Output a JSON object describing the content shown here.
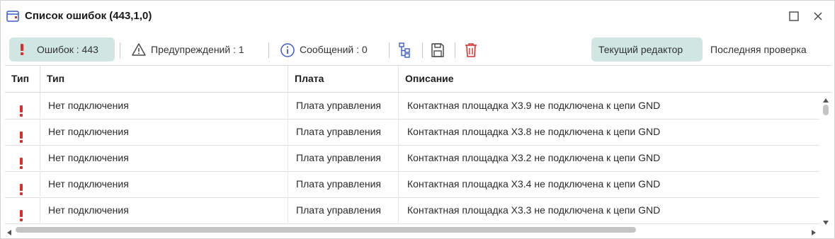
{
  "window": {
    "title": "Список ошибок (443,1,0)",
    "icon": "error-list-window-icon",
    "controls": [
      "maximize-icon",
      "close-icon"
    ]
  },
  "toolbar": {
    "errors_label": "Ошибок : 443",
    "warnings_label": "Предупреждений : 1",
    "messages_label": "Сообщений : 0",
    "icons": [
      "error-icon",
      "warning-icon",
      "info-icon",
      "tree-view-icon",
      "save-icon",
      "delete-icon"
    ],
    "current_editor_label": "Текущий редактор",
    "last_check_label": "Последняя проверка"
  },
  "table": {
    "columns": [
      "Тип",
      "Тип",
      "Плата",
      "Описание"
    ],
    "rows": [
      {
        "severity": "error",
        "type": "Нет подключения",
        "board": "Плата управления",
        "description": "Контактная площадка X3.9 не подключена к цепи GND"
      },
      {
        "severity": "error",
        "type": "Нет подключения",
        "board": "Плата управления",
        "description": "Контактная площадка X3.8 не подключена к цепи GND"
      },
      {
        "severity": "error",
        "type": "Нет подключения",
        "board": "Плата управления",
        "description": "Контактная площадка X3.2 не подключена к цепи GND"
      },
      {
        "severity": "error",
        "type": "Нет подключения",
        "board": "Плата управления",
        "description": "Контактная площадка X3.4 не подключена к цепи GND"
      },
      {
        "severity": "error",
        "type": "Нет подключения",
        "board": "Плата управления",
        "description": "Контактная площадка X3.3 не подключена к цепи GND"
      }
    ]
  },
  "colors": {
    "accent_bg": "#cfe6e3",
    "error": "#d9302c",
    "warning_outline": "#4a4a4a",
    "info": "#3a5bd0",
    "delete": "#d9302c"
  }
}
